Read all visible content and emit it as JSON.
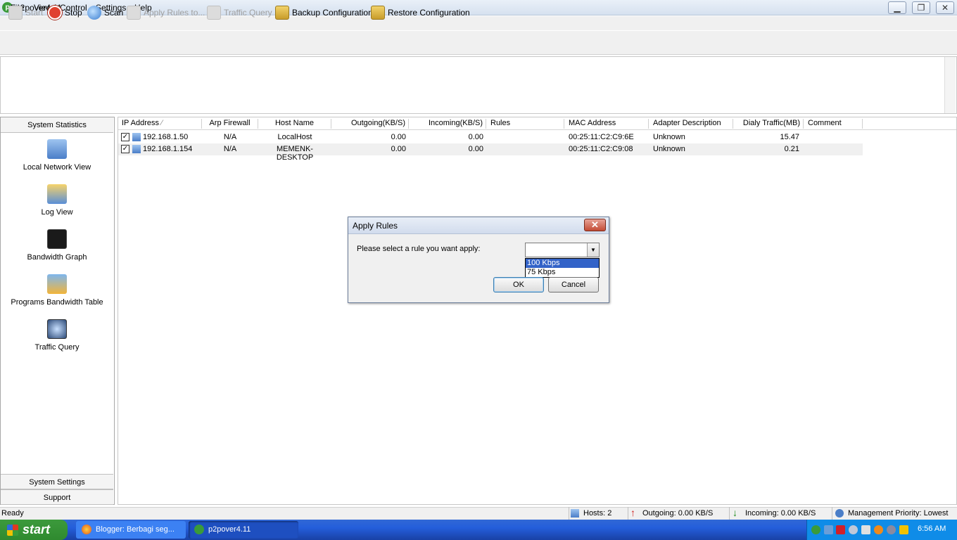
{
  "window": {
    "title": "p2pover4.11",
    "app_icon": "p2pover-icon",
    "controls": [
      "minimize",
      "restore",
      "close"
    ]
  },
  "menu": [
    "File",
    "View",
    "Control",
    "Settings",
    "Help"
  ],
  "toolbar": {
    "start": "Start",
    "stop": "Stop",
    "scan": "Scan",
    "apply_rules": "Apply Rules to...",
    "traffic_query": "Traffic Query",
    "backup": "Backup Configuration",
    "restore": "Restore Configuration"
  },
  "sidebar": {
    "header": "System Statistics",
    "items": [
      "Local Network View",
      "Log View",
      "Bandwidth Graph",
      "Programs Bandwidth Table",
      "Traffic Query"
    ],
    "bottom": [
      "System Settings",
      "Support"
    ]
  },
  "table": {
    "columns": [
      "IP Address",
      "Arp Firewall",
      "Host Name",
      "Outgoing(KB/S)",
      "Incoming(KB/S)",
      "Rules",
      "MAC Address",
      "Adapter Description",
      "Dialy Traffic(MB)",
      "Comment"
    ],
    "rows": [
      {
        "ip": "192.168.1.50",
        "arp": "N/A",
        "host": "LocalHost",
        "out": "0.00",
        "in": "0.00",
        "rules": "",
        "mac": "00:25:11:C2:C9:6E",
        "adapter": "Unknown",
        "traffic": "15.47",
        "comment": "",
        "checked": true
      },
      {
        "ip": "192.168.1.154",
        "arp": "N/A",
        "host": "MEMENK-DESKTOP",
        "out": "0.00",
        "in": "0.00",
        "rules": "",
        "mac": "00:25:11:C2:C9:08",
        "adapter": "Unknown",
        "traffic": "0.21",
        "comment": "",
        "checked": true
      }
    ]
  },
  "dialog": {
    "title": "Apply Rules",
    "prompt": "Please select a rule you want apply:",
    "selected_value": "",
    "options": [
      "100 Kbps",
      "75 Kbps"
    ],
    "highlighted_option": "100 Kbps",
    "ok": "OK",
    "cancel": "Cancel"
  },
  "status": {
    "ready": "Ready",
    "hosts": "Hosts: 2",
    "outgoing": "Outgoing: 0.00 KB/S",
    "incoming": "Incoming: 0.00 KB/S",
    "priority": "Management Priority: Lowest"
  },
  "taskbar": {
    "start": "start",
    "tasks": [
      "Blogger: Berbagi seg...",
      "p2pover4.11"
    ],
    "clock": "6:56 AM"
  },
  "colors": {
    "selection": "#3363c8",
    "taskbar": "#245edb",
    "start": "#3a9b3a"
  }
}
